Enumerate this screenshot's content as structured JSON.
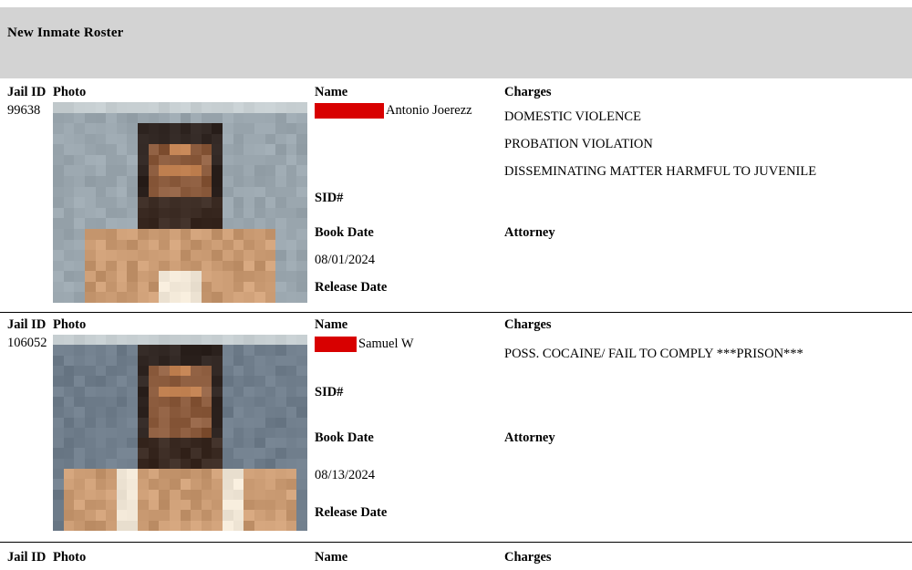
{
  "header": {
    "title": "New Inmate Roster",
    "band_color": "#d3d3d3"
  },
  "columns": {
    "jail_id": "Jail ID",
    "photo": "Photo",
    "name": "Name",
    "charges": "Charges"
  },
  "field_labels": {
    "sid": "SID#",
    "book_date": "Book Date",
    "release_date": "Release Date",
    "attorney": "Attorney"
  },
  "redaction_color": "#d80000",
  "records": [
    {
      "jail_id": "99638",
      "name": "Antonio Joerezz",
      "name_redaction_width": 76,
      "charges": [
        "DOMESTIC VIOLENCE",
        "PROBATION VIOLATION",
        "DISSEMINATING MATTER HARMFUL TO JUVENILE"
      ],
      "sid": "",
      "book_date": "08/01/2024",
      "release_date": "",
      "attorney": "",
      "photo_alt": "pixelated-mugshot"
    },
    {
      "jail_id": "106052",
      "name": "Samuel W",
      "name_redaction_width": 46,
      "charges": [
        "POSS. COCAINE/ FAIL TO COMPLY ***PRISON***"
      ],
      "sid": "",
      "book_date": "08/13/2024",
      "release_date": "",
      "attorney": "",
      "photo_alt": "pixelated-mugshot"
    },
    {
      "jail_id": "",
      "name": "",
      "name_redaction_width": 0,
      "charges": [],
      "sid": "",
      "book_date": "",
      "release_date": "",
      "attorney": "",
      "photo_alt": ""
    }
  ]
}
